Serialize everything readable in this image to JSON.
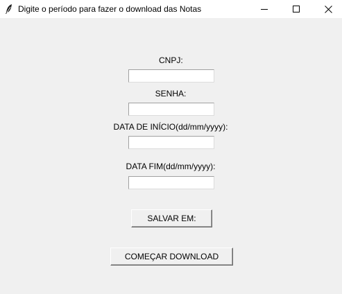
{
  "window": {
    "title": "Digite o período para fazer o download das Notas",
    "app_icon": "feather-icon",
    "controls": [
      "minimize-icon",
      "maximize-icon",
      "close-icon"
    ]
  },
  "form": {
    "cnpj_label": "CNPJ:",
    "cnpj_value": "",
    "senha_label": "SENHA:",
    "senha_value": "",
    "data_inicio_label": "DATA DE INÍCIO(dd/mm/yyyy):",
    "data_inicio_value": "",
    "data_fim_label": "DATA FIM(dd/mm/yyyy):",
    "data_fim_value": ""
  },
  "buttons": {
    "salvar_em": "SALVAR EM:",
    "comecar_download": "COMEÇAR DOWNLOAD"
  }
}
